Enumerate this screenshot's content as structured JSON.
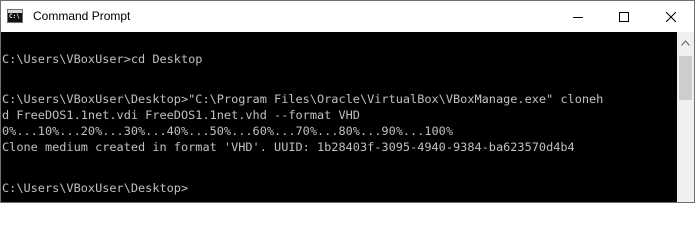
{
  "window": {
    "title": "Command Prompt",
    "app_icon_text": "C:\\",
    "icons": {
      "app": "command-prompt-icon",
      "minimize": "minimize-icon",
      "maximize": "maximize-icon",
      "close": "close-icon",
      "scroll_up": "chevron-up-icon"
    }
  },
  "console": {
    "lines": [
      "C:\\Users\\VBoxUser>cd Desktop",
      "C:\\Users\\VBoxUser\\Desktop>\"C:\\Program Files\\Oracle\\VirtualBox\\VBoxManage.exe\" cloneh",
      "d FreeDOS1.1net.vdi FreeDOS1.1net.vhd --format VHD",
      "0%...10%...20%...30%...40%...50%...60%...70%...80%...90%...100%",
      "Clone medium created in format 'VHD'. UUID: 1b28403f-3095-4940-9384-ba623570d4b4",
      "C:\\Users\\VBoxUser\\Desktop>"
    ]
  },
  "colors": {
    "console_background": "#000000",
    "console_text": "#c0c0c0",
    "titlebar": "#ffffff"
  }
}
